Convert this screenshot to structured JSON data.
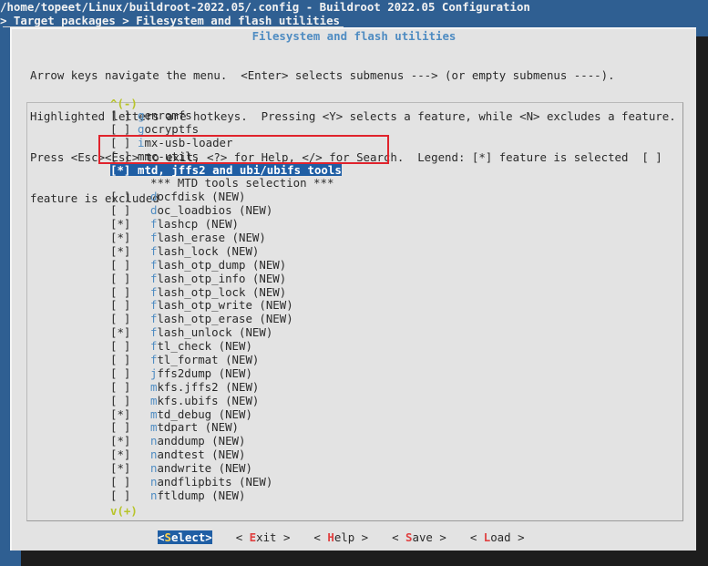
{
  "window": {
    "title": "/home/topeet/Linux/buildroot-2022.05/.config - Buildroot 2022.05 Configuration",
    "breadcrumb": "> Target packages > Filesystem and flash utilities"
  },
  "dialog": {
    "title": "Filesystem and flash utilities",
    "help_lines": [
      "Arrow keys navigate the menu.  <Enter> selects submenus ---> (or empty submenus ----).",
      "Highlighted letters are hotkeys.  Pressing <Y> selects a feature, while <N> excludes a feature.",
      "Press <Esc><Esc> to exit, <?> for Help, </> for Search.  Legend: [*] feature is selected  [ ]",
      "feature is excluded"
    ],
    "scroll_up": "^(-)",
    "scroll_down": "v(+)"
  },
  "menu": {
    "items": [
      {
        "mark": "[ ]",
        "hot": "g",
        "rest": "enromfs",
        "type": "normal"
      },
      {
        "mark": "[ ]",
        "hot": "g",
        "rest": "ocryptfs",
        "type": "normal"
      },
      {
        "mark": "[ ]",
        "hot": "i",
        "rest": "mx-usb-loader",
        "type": "normal"
      },
      {
        "mark": "[ ]",
        "hot": "",
        "rest": "mmc-utils",
        "type": "normal"
      },
      {
        "mark": "[*]",
        "hot": "m",
        "rest": "td, jffs2 and ubi/ubifs tools",
        "type": "selected"
      },
      {
        "mark": "",
        "hot": "",
        "rest": "*** MTD tools selection ***",
        "type": "comment"
      },
      {
        "mark": "[ ]",
        "hot": "d",
        "rest": "ocfdisk (NEW)",
        "type": "indent"
      },
      {
        "mark": "[ ]",
        "hot": "d",
        "rest": "oc_loadbios (NEW)",
        "type": "indent"
      },
      {
        "mark": "[*]",
        "hot": "f",
        "rest": "lashcp (NEW)",
        "type": "indent"
      },
      {
        "mark": "[*]",
        "hot": "f",
        "rest": "lash_erase (NEW)",
        "type": "indent"
      },
      {
        "mark": "[*]",
        "hot": "f",
        "rest": "lash_lock (NEW)",
        "type": "indent"
      },
      {
        "mark": "[ ]",
        "hot": "f",
        "rest": "lash_otp_dump (NEW)",
        "type": "indent"
      },
      {
        "mark": "[ ]",
        "hot": "f",
        "rest": "lash_otp_info (NEW)",
        "type": "indent"
      },
      {
        "mark": "[ ]",
        "hot": "f",
        "rest": "lash_otp_lock (NEW)",
        "type": "indent"
      },
      {
        "mark": "[ ]",
        "hot": "f",
        "rest": "lash_otp_write (NEW)",
        "type": "indent"
      },
      {
        "mark": "[ ]",
        "hot": "f",
        "rest": "lash_otp_erase (NEW)",
        "type": "indent"
      },
      {
        "mark": "[*]",
        "hot": "f",
        "rest": "lash_unlock (NEW)",
        "type": "indent"
      },
      {
        "mark": "[ ]",
        "hot": "f",
        "rest": "tl_check (NEW)",
        "type": "indent"
      },
      {
        "mark": "[ ]",
        "hot": "f",
        "rest": "tl_format (NEW)",
        "type": "indent"
      },
      {
        "mark": "[ ]",
        "hot": "j",
        "rest": "ffs2dump (NEW)",
        "type": "indent"
      },
      {
        "mark": "[ ]",
        "hot": "m",
        "rest": "kfs.jffs2 (NEW)",
        "type": "indent"
      },
      {
        "mark": "[ ]",
        "hot": "m",
        "rest": "kfs.ubifs (NEW)",
        "type": "indent"
      },
      {
        "mark": "[*]",
        "hot": "m",
        "rest": "td_debug (NEW)",
        "type": "indent"
      },
      {
        "mark": "[ ]",
        "hot": "m",
        "rest": "tdpart (NEW)",
        "type": "indent"
      },
      {
        "mark": "[*]",
        "hot": "n",
        "rest": "anddump (NEW)",
        "type": "indent"
      },
      {
        "mark": "[*]",
        "hot": "n",
        "rest": "andtest (NEW)",
        "type": "indent"
      },
      {
        "mark": "[*]",
        "hot": "n",
        "rest": "andwrite (NEW)",
        "type": "indent"
      },
      {
        "mark": "[ ]",
        "hot": "n",
        "rest": "andflipbits (NEW)",
        "type": "indent"
      },
      {
        "mark": "[ ]",
        "hot": "n",
        "rest": "ftldump (NEW)",
        "type": "indent"
      }
    ]
  },
  "buttons": [
    {
      "pre": "<",
      "hot": "S",
      "rest": "elect",
      "post": ">",
      "active": true,
      "name": "select-button"
    },
    {
      "pre": "< ",
      "hot": "E",
      "rest": "xit",
      "post": " >",
      "active": false,
      "name": "exit-button"
    },
    {
      "pre": "< ",
      "hot": "H",
      "rest": "elp",
      "post": " >",
      "active": false,
      "name": "help-button"
    },
    {
      "pre": "< ",
      "hot": "S",
      "rest": "ave",
      "post": " >",
      "active": false,
      "name": "save-button"
    },
    {
      "pre": "< ",
      "hot": "L",
      "rest": "oad",
      "post": " >",
      "active": false,
      "name": "load-button"
    }
  ],
  "colors": {
    "background": "#2f5f92",
    "dialog": "#e3e3e3",
    "highlight": "#1f5ea4",
    "hotkey": "#4f8cc2",
    "annotation": "#e0232c"
  }
}
